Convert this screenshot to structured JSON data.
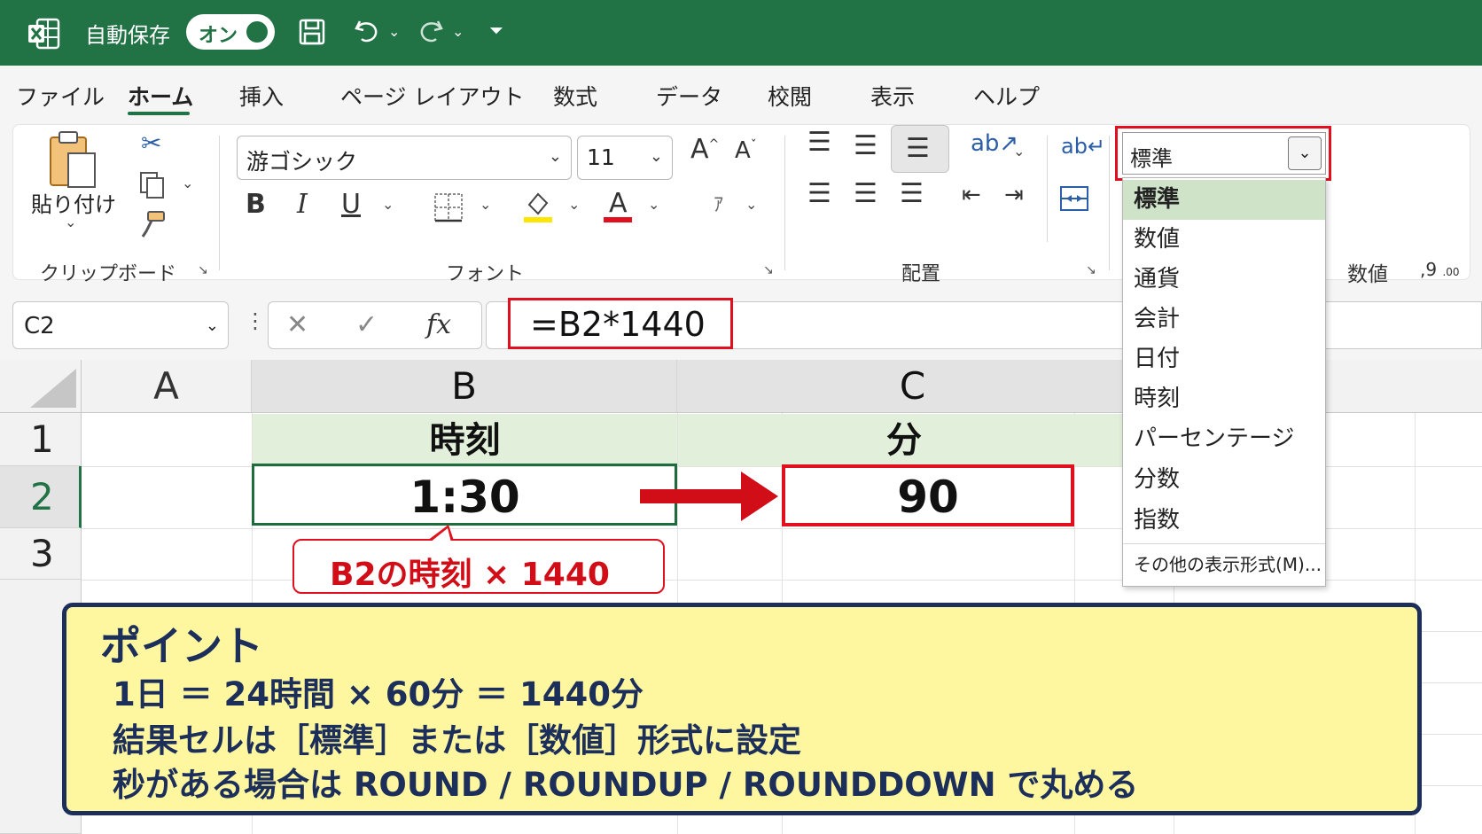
{
  "titlebar": {
    "autosave_label": "自動保存",
    "toggle_label": "オン"
  },
  "tabs": [
    "ファイル",
    "ホーム",
    "挿入",
    "ページ レイアウト",
    "数式",
    "データ",
    "校閲",
    "表示",
    "ヘルプ"
  ],
  "active_tab": "ホーム",
  "ribbon": {
    "clipboard": {
      "paste_label": "貼り付け",
      "group_label": "クリップボード"
    },
    "font": {
      "font_name": "游ゴシック",
      "font_size": "11",
      "group_label": "フォント"
    },
    "alignment": {
      "group_label": "配置"
    },
    "number": {
      "group_label": "数値",
      "format_value": "標準"
    }
  },
  "formula_bar": {
    "name_box": "C2",
    "formula": "=B2*1440"
  },
  "grid": {
    "columns": [
      "A",
      "B",
      "C"
    ],
    "rows": [
      "1",
      "2",
      "3"
    ],
    "b1": "時刻",
    "c1": "分",
    "b2": "1:30",
    "c2": "90"
  },
  "callout": {
    "text": "B2の時刻 × 1440"
  },
  "number_format_dropdown": {
    "items": [
      "標準",
      "数値",
      "通貨",
      "会計",
      "日付",
      "時刻",
      "パーセンテージ",
      "分数",
      "指数"
    ],
    "selected": "標準",
    "more": "その他の表示形式(M)..."
  },
  "point_box": {
    "title": "ポイント",
    "lines": [
      "1日 ＝ 24時間 × 60分 ＝ 1440分",
      "結果セルは［標準］または［数値］形式に設定",
      "秒がある場合は ROUND / ROUNDUP /  ROUNDDOWN で丸める"
    ]
  },
  "colors": {
    "excel_green": "#217346",
    "highlight_red": "#e0101e",
    "header_fill": "#e2efda",
    "point_bg": "#fff7a0",
    "point_border": "#1c2e5a"
  }
}
